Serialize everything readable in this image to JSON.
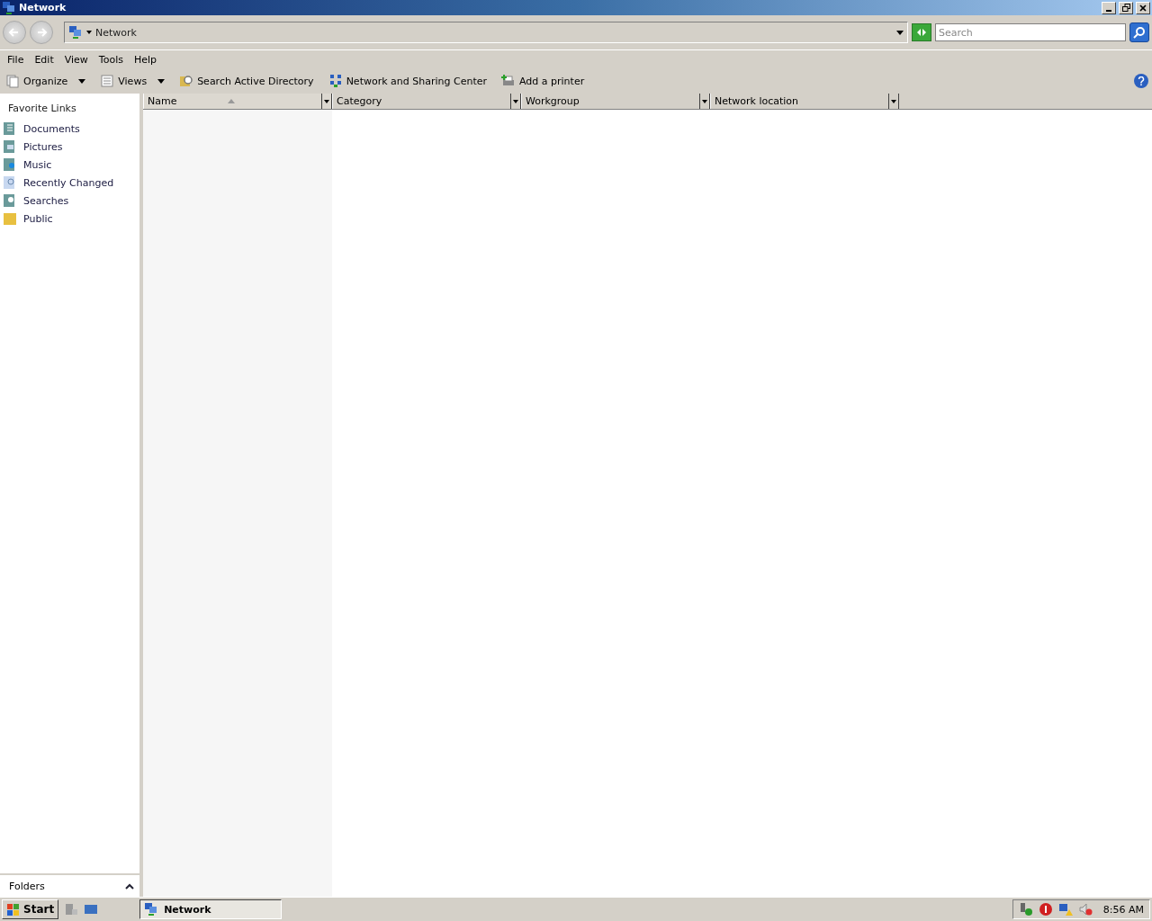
{
  "window": {
    "title": "Network"
  },
  "address": {
    "path": "Network"
  },
  "search": {
    "placeholder": "Search"
  },
  "menu": [
    "File",
    "Edit",
    "View",
    "Tools",
    "Help"
  ],
  "toolbar": [
    {
      "kind": "organize",
      "label": "Organize",
      "dropdown": true
    },
    {
      "kind": "views",
      "label": "Views",
      "dropdown": true
    },
    {
      "kind": "directory",
      "label": "Search Active Directory",
      "dropdown": false
    },
    {
      "kind": "network",
      "label": "Network and Sharing Center",
      "dropdown": false
    },
    {
      "kind": "printer",
      "label": "Add a printer",
      "dropdown": false
    }
  ],
  "sidebar": {
    "title": "Favorite Links",
    "items": [
      {
        "kind": "documents",
        "label": "Documents"
      },
      {
        "kind": "pictures",
        "label": "Pictures"
      },
      {
        "kind": "music",
        "label": "Music"
      },
      {
        "kind": "recent",
        "label": "Recently Changed"
      },
      {
        "kind": "searches",
        "label": "Searches"
      },
      {
        "kind": "public",
        "label": "Public"
      }
    ],
    "folders": {
      "label": "Folders",
      "expanded": false
    }
  },
  "table": {
    "columns": [
      {
        "label": "Name",
        "sorted": true
      },
      {
        "label": "Category",
        "sorted": false
      },
      {
        "label": "Workgroup",
        "sorted": false
      },
      {
        "label": "Network location",
        "sorted": false
      }
    ]
  },
  "taskbar": {
    "start": "Start",
    "tasks": [
      {
        "label": "Network",
        "selected": true
      }
    ],
    "clock": "8:56 AM"
  }
}
